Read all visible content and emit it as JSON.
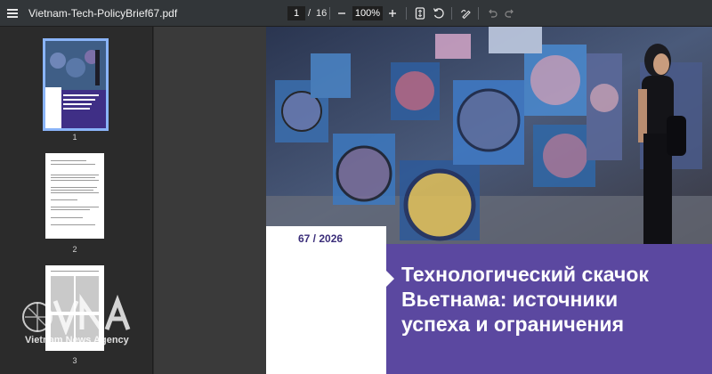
{
  "toolbar": {
    "filename": "Vietnam-Tech-PolicyBrief67.pdf",
    "current_page": "1",
    "page_separator": "/",
    "total_pages": "16",
    "zoom": "100%",
    "zoom_out_icon": "minus-icon",
    "zoom_in_icon": "plus-icon"
  },
  "sidebar": {
    "thumbnails": [
      {
        "page_number": "1"
      },
      {
        "page_number": "2"
      },
      {
        "page_number": "3"
      }
    ]
  },
  "document": {
    "issue": "67 / 2026",
    "headline_lines": [
      "Технологический скачок",
      "Вьетнама: источники",
      "успеха и ограничения"
    ],
    "band_color": "#5b48a0"
  },
  "watermark": {
    "text": "Vietnam News Agency"
  }
}
